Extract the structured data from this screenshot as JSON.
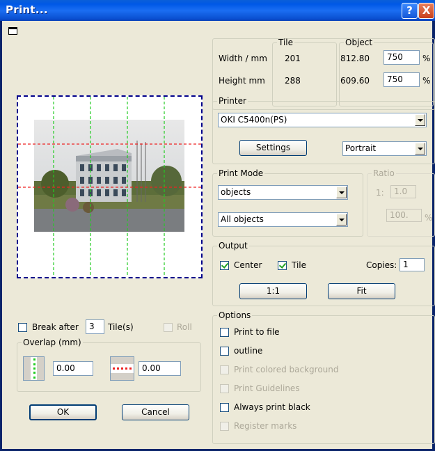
{
  "title": "Print...",
  "titlebar": {
    "help_glyph": "?",
    "close_glyph": "X"
  },
  "size": {
    "tile_header": "Tile",
    "object_header": "Object",
    "width_label": "Width / mm",
    "height_label": "Height mm",
    "tile_width": "201",
    "tile_height": "288",
    "object_width": "812.80",
    "object_height": "609.60",
    "width_percent": "750",
    "height_percent": "750",
    "percent_sign": "%"
  },
  "printer": {
    "legend": "Printer",
    "selected": "OKI C5400n(PS)",
    "settings_label": "Settings",
    "orientation": "Portrait"
  },
  "print_mode": {
    "legend": "Print Mode",
    "mode": "objects",
    "selection": "All objects"
  },
  "ratio": {
    "legend": "Ratio",
    "prefix": "1:",
    "value": "1.0",
    "percent_value": "100.",
    "percent_sign": "%"
  },
  "output": {
    "legend": "Output",
    "center_label": "Center",
    "center_checked": true,
    "tile_label": "Tile",
    "tile_checked": true,
    "copies_label": "Copies:",
    "copies_value": "1",
    "one_to_one_label": "1:1",
    "fit_label": "Fit"
  },
  "options": {
    "legend": "Options",
    "items": [
      {
        "label": "Print to file",
        "enabled": true,
        "checked": false
      },
      {
        "label": "outline",
        "enabled": true,
        "checked": false
      },
      {
        "label": "Print colored background",
        "enabled": false,
        "checked": false
      },
      {
        "label": "Print Guidelines",
        "enabled": false,
        "checked": false
      },
      {
        "label": "Always print black",
        "enabled": true,
        "checked": false
      },
      {
        "label": "Register marks",
        "enabled": false,
        "checked": false
      }
    ]
  },
  "break": {
    "label": "Break after",
    "value": "3",
    "suffix": "Tile(s)",
    "roll_label": "Roll"
  },
  "overlap": {
    "legend": "Overlap (mm)",
    "vertical_value": "0.00",
    "horizontal_value": "0.00"
  },
  "buttons": {
    "ok": "OK",
    "cancel": "Cancel"
  },
  "colors": {
    "titlebar": "#0058e6",
    "dialog_bg": "#ece9d8",
    "preview_border": "#00008b",
    "vertical_cut": "#22cc22",
    "horizontal_cut": "#ee2222"
  }
}
